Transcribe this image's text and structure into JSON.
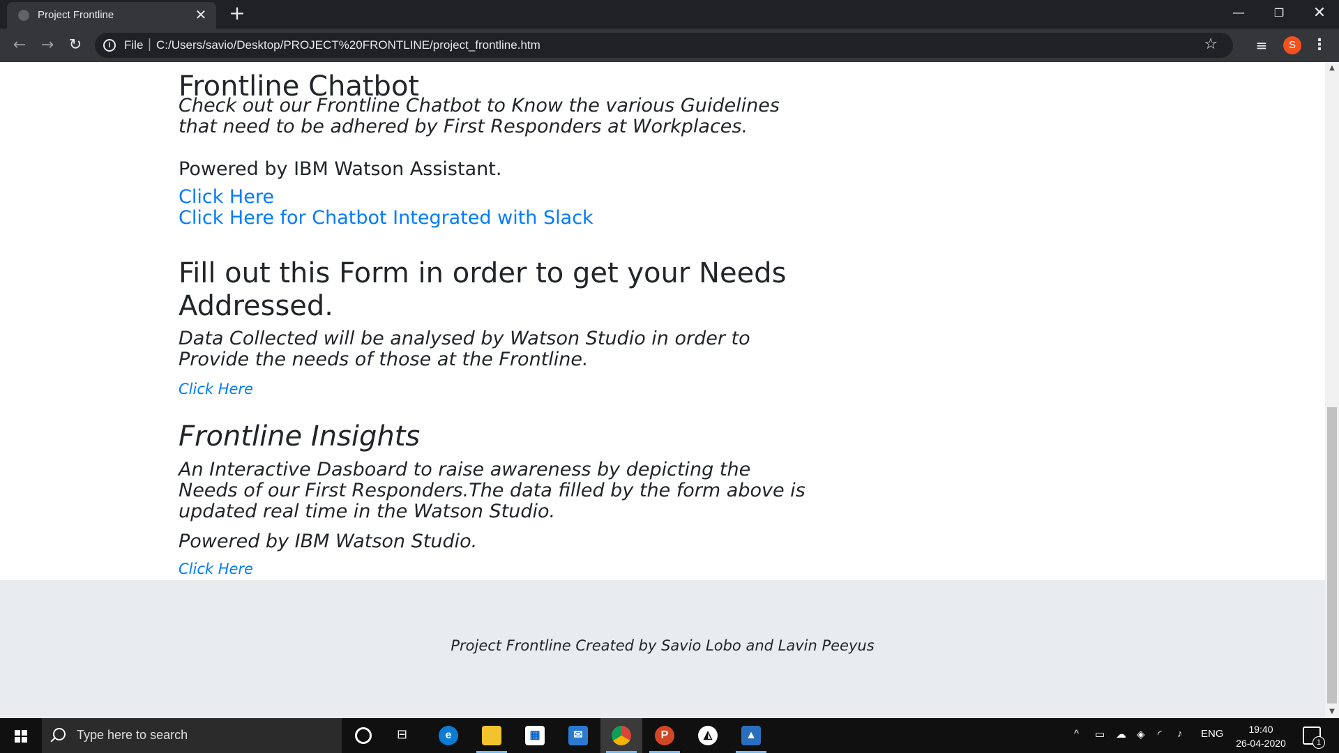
{
  "browser": {
    "tab_title": "Project Frontline",
    "tab_close": "✕",
    "new_tab": "+",
    "scheme": "File",
    "separator": "|",
    "url": "C:/Users/savio/Desktop/PROJECT%20FRONTLINE/project_frontline.htm",
    "profile_initial": "S",
    "window_controls": {
      "minimize": "—",
      "maximize": "❐",
      "close": "✕"
    },
    "nav": {
      "back": "←",
      "forward": "→",
      "reload": "↻"
    },
    "star": "☆",
    "menu": "⋮",
    "profile_color": "#f4511e"
  },
  "page": {
    "chatbot": {
      "title": "Frontline Chatbot",
      "description": "Check out our Frontline Chatbot to Know the various Guidelines that need to be adhered by First Responders at Workplaces.",
      "powered": "Powered by IBM Watson Assistant.",
      "link1": "Click Here",
      "link2": "Click Here for Chatbot Integrated with Slack"
    },
    "form": {
      "title_line1": "Fill out this Form in order to get your Needs",
      "title_line2": "Addressed.",
      "description": "Data Collected will be analysed by Watson Studio in order to Provide the needs of those at the Frontline.",
      "link": "Click Here"
    },
    "insights": {
      "title": "Frontline Insights",
      "description": "An Interactive Dasboard to raise awareness by depicting the Needs of our First Responders.The data filled by the form above is updated real time in the Watson Studio.",
      "powered": "Powered by IBM Watson Studio.",
      "link": "Click Here"
    },
    "footer": "Project Frontline Created by Savio Lobo and Lavin Peeyus",
    "link_color": "#007bff",
    "footer_bg": "#e9ecef"
  },
  "taskbar": {
    "search_placeholder": "Type here to search",
    "apps": [
      "edge-icon",
      "file-explorer-icon",
      "store-icon",
      "mail-icon",
      "chrome-icon",
      "powerpoint-icon",
      "photos-app-icon",
      "image-viewer-icon"
    ],
    "tray_lang": "ENG",
    "time": "19:40",
    "date": "26-04-2020",
    "notification_count": "1"
  }
}
